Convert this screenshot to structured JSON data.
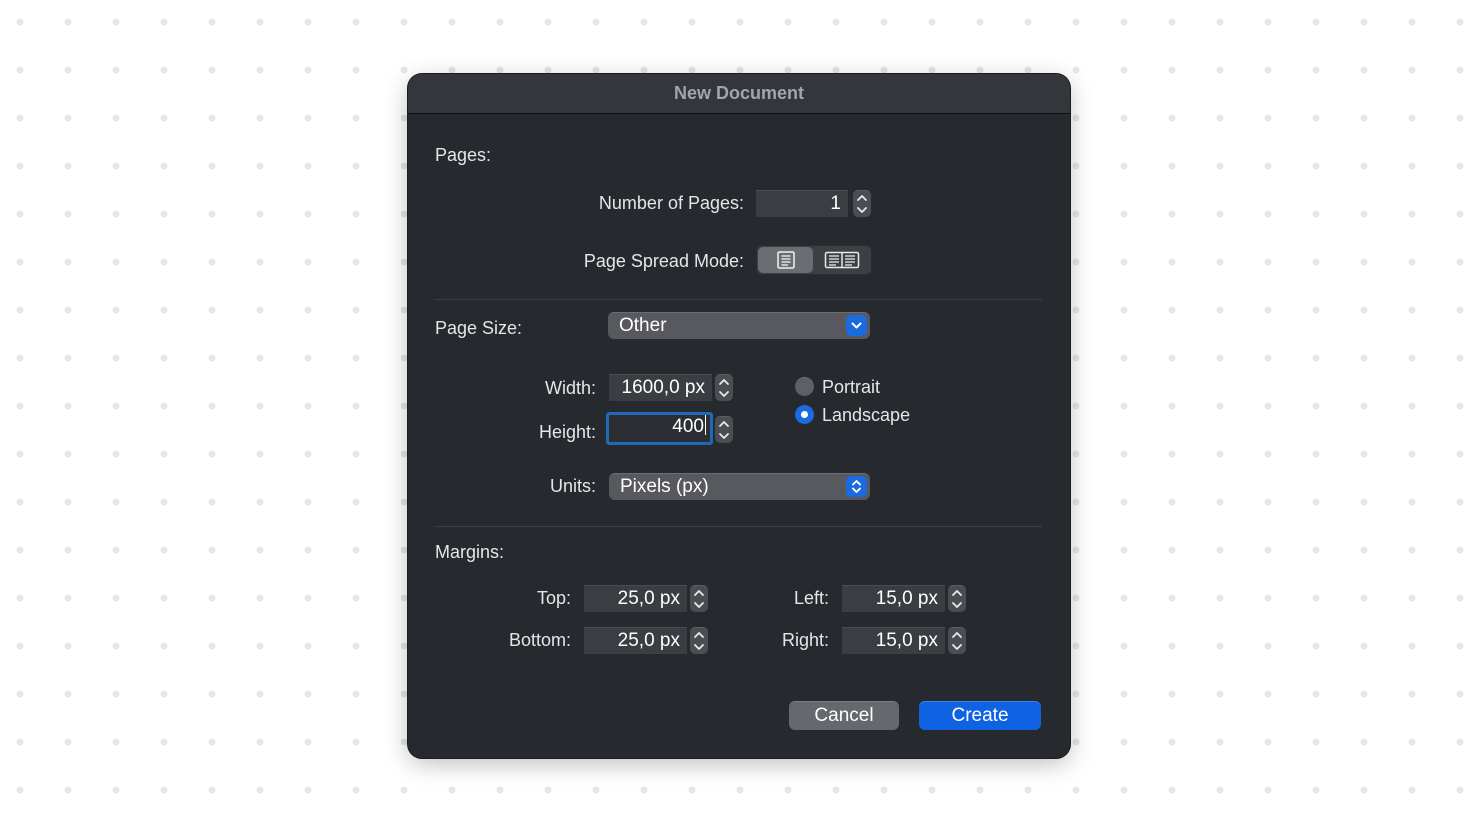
{
  "dialog": {
    "title": "New Document"
  },
  "pages": {
    "section_label": "Pages:",
    "number_label": "Number of Pages:",
    "number_value": "1",
    "spread_label": "Page Spread Mode:",
    "spread_options": [
      "single-page-icon",
      "double-page-icon"
    ],
    "spread_selected": 0
  },
  "page_size": {
    "label": "Page Size:",
    "preset": "Other",
    "width_label": "Width:",
    "width_value": "1600,0 px",
    "height_label": "Height:",
    "height_value": "400",
    "orientation": {
      "portrait_label": "Portrait",
      "landscape_label": "Landscape",
      "selected": "landscape"
    },
    "units_label": "Units:",
    "units_value": "Pixels (px)"
  },
  "margins": {
    "section_label": "Margins:",
    "top_label": "Top:",
    "top_value": "25,0 px",
    "bottom_label": "Bottom:",
    "bottom_value": "25,0 px",
    "left_label": "Left:",
    "left_value": "15,0 px",
    "right_label": "Right:",
    "right_value": "15,0 px"
  },
  "buttons": {
    "cancel_label": "Cancel",
    "create_label": "Create"
  },
  "colors": {
    "dialog_bg": "#26292d",
    "accent": "#0f63e3",
    "focus_ring": "#1e69b8"
  }
}
